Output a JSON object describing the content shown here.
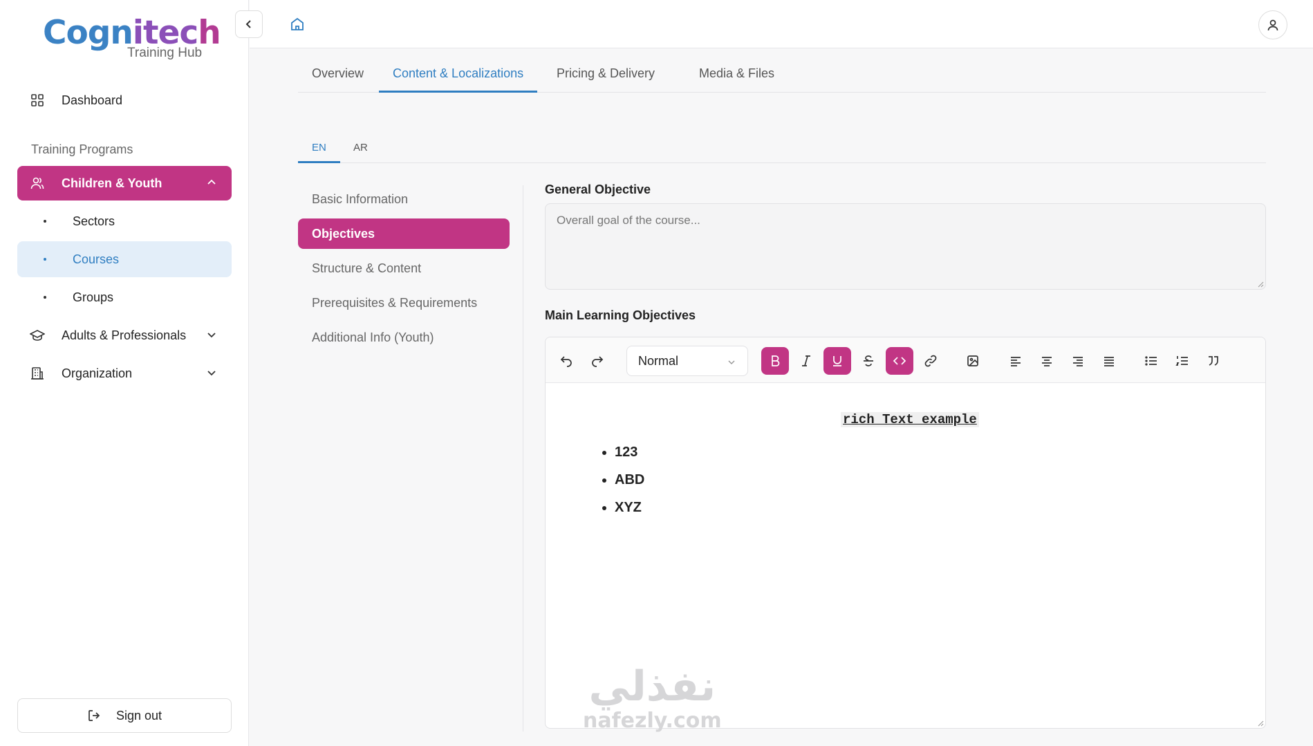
{
  "brand": {
    "name_part1": "Cogn",
    "name_part2": "itec",
    "name_part3": "h",
    "subtitle": "Training Hub"
  },
  "sidebar": {
    "dashboard": "Dashboard",
    "section_label": "Training Programs",
    "children_youth": "Children & Youth",
    "sub_items": [
      "Sectors",
      "Courses",
      "Groups"
    ],
    "adults": "Adults & Professionals",
    "organization": "Organization",
    "sign_out": "Sign out"
  },
  "tabs": [
    "Overview",
    "Content & Localizations",
    "Pricing & Delivery",
    "Media & Files"
  ],
  "lang_tabs": [
    "EN",
    "AR"
  ],
  "sections": [
    "Basic Information",
    "Objectives",
    "Structure & Content",
    "Prerequisites & Requirements",
    "Additional Info (Youth)"
  ],
  "form": {
    "general_objective_label": "General Objective",
    "general_objective_placeholder": "Overall goal of the course...",
    "main_objectives_label": "Main Learning Objectives",
    "format_select": "Normal",
    "rich_title": "rich Text example",
    "rich_items": [
      "123",
      "ABD",
      "XYZ"
    ]
  },
  "watermark": {
    "arabic": "نفذلي",
    "latin": "nafezly.com"
  },
  "colors": {
    "accent": "#c13584",
    "link": "#2f7ec1"
  }
}
